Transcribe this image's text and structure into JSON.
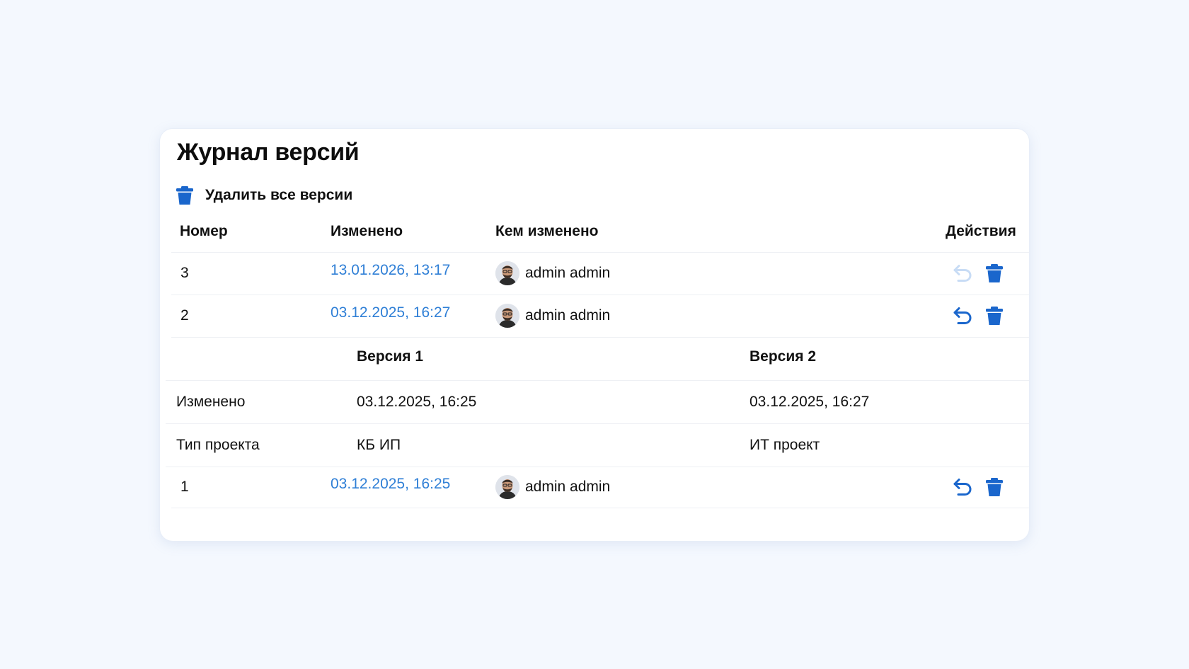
{
  "panel": {
    "title": "Журнал версий",
    "delete_all_label": "Удалить все версии"
  },
  "table": {
    "headers": {
      "number": "Номер",
      "changed": "Изменено",
      "changed_by": "Кем изменено",
      "actions": "Действия"
    },
    "rows": [
      {
        "number": "3",
        "date": "13.01.2026, 13:17",
        "author": "admin admin",
        "restore_enabled": false
      },
      {
        "number": "2",
        "date": "03.12.2025, 16:27",
        "author": "admin admin",
        "restore_enabled": true
      },
      {
        "number": "1",
        "date": "03.12.2025, 16:25",
        "author": "admin admin",
        "restore_enabled": true
      }
    ]
  },
  "comparison": {
    "headers": {
      "version1": "Версия 1",
      "version2": "Версия 2"
    },
    "rows": [
      {
        "field": "Изменено",
        "v1": "03.12.2025, 16:25",
        "v2": "03.12.2025, 16:27"
      },
      {
        "field": "Тип проекта",
        "v1": "КБ ИП",
        "v2": "ИТ проект"
      }
    ]
  },
  "icons": {
    "delete": "trash-icon",
    "restore": "undo-arrow-icon",
    "avatar": "user-avatar"
  },
  "colors": {
    "accent": "#1a66cc",
    "link": "#2f7fd6",
    "disabled": "#c8dcf5",
    "background": "#f4f8fe"
  }
}
